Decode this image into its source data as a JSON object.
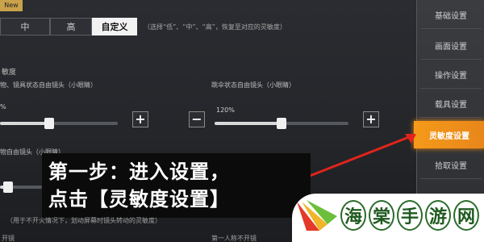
{
  "top_badge": "New",
  "presets": {
    "buttons": [
      "中",
      "高",
      "自定义"
    ],
    "active_index": 2,
    "note": "（选择“低”、“中”、“高”，恢复至对应的灵敏度）"
  },
  "section": {
    "title": "敏度",
    "left_label": "物、镜具状态自由镜头（小眼睛）",
    "right_label": "跳伞状态自由镜头（小眼睛）",
    "left_percent": "%",
    "right_percent": "120%",
    "lower_label": "物自由镜头（小眼睛）",
    "left_slider_level": 0.42,
    "right_slider_level": 0.5,
    "lower_slider_level": 0.2
  },
  "sidebar": {
    "items": [
      "基础设置",
      "画面设置",
      "操作设置",
      "载具设置",
      "灵敏度设置",
      "拾取设置"
    ],
    "active_index": 4
  },
  "caption": {
    "line1": "第一步：进入设置，",
    "line2": "点击【灵敏度设置】"
  },
  "footnote": "（用于不开火情况下，划动屏幕时镜头转动的灵敏度）",
  "bottom": {
    "left": "开镜",
    "right": "第一人称不开镜"
  },
  "watermark": {
    "chars": [
      "海",
      "棠",
      "手",
      "游",
      "网"
    ]
  },
  "colors": {
    "accent": "#f59a1a",
    "arrow": "#e0241b",
    "watermark_green": "#2a6b2a"
  }
}
